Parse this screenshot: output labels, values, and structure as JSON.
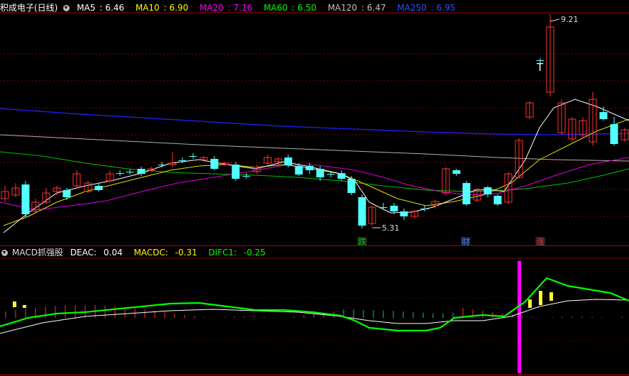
{
  "main": {
    "stock_name": "积成电子(日线)",
    "ma": [
      {
        "label": "MA5",
        "value": "6.46",
        "color": "#ffffff"
      },
      {
        "label": "MA10",
        "value": "6.90",
        "color": "#ffff00"
      },
      {
        "label": "MA20",
        "value": "7.16",
        "color": "#ff00ff"
      },
      {
        "label": "MA60",
        "value": "6.50",
        "color": "#00ff00"
      },
      {
        "label": "MA120",
        "value": "6.47",
        "color": "#c0c0c0"
      },
      {
        "label": "MA250",
        "value": "6.95",
        "color": "#0000ff"
      }
    ],
    "high_label": "9.21",
    "low_label": "5.31",
    "markers": [
      {
        "text": "跌",
        "color": "#00c000"
      },
      {
        "text": "财",
        "color": "#4080ff"
      },
      {
        "text": "涨",
        "color": "#ff3030"
      }
    ],
    "t_mark": "T"
  },
  "sub": {
    "name": "MACD抓强股",
    "items": [
      {
        "label": "DEAC:",
        "value": "0.04",
        "color": "#ffffff"
      },
      {
        "label": "MACDC:",
        "value": "-0.31",
        "color": "#ffff00"
      },
      {
        "label": "DIFC1:",
        "value": "-0.25",
        "color": "#00ff00"
      }
    ]
  }
}
